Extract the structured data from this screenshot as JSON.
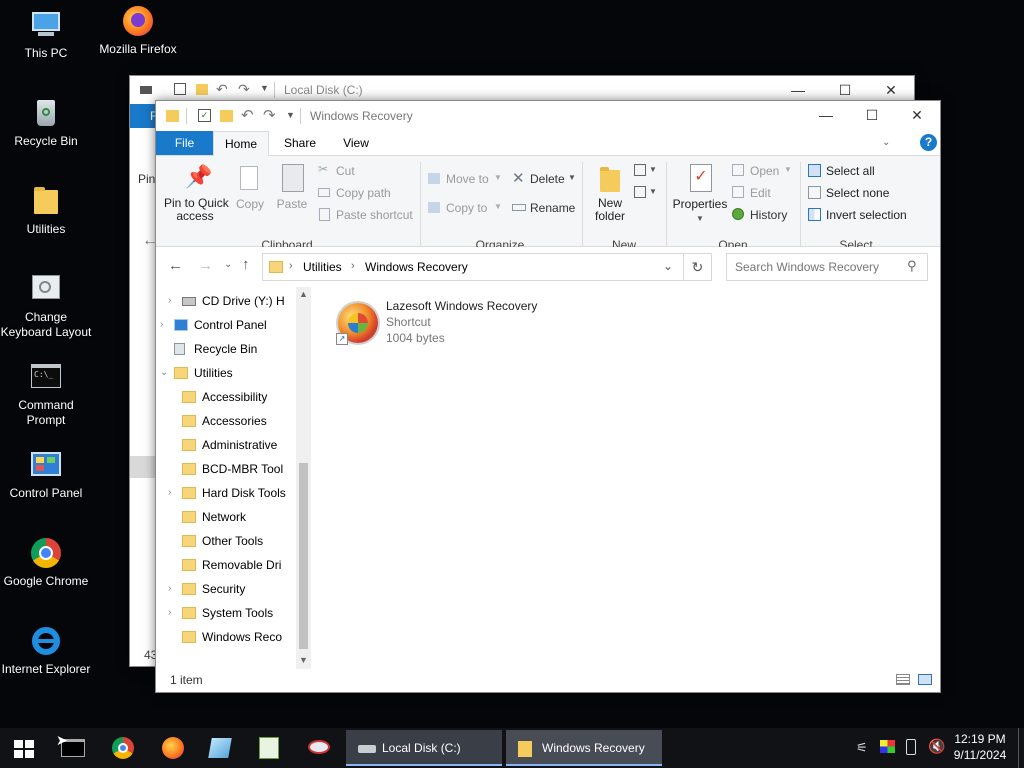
{
  "desktop": {
    "icons": [
      {
        "label": "This PC",
        "icon": "this-pc-icon"
      },
      {
        "label": "Mozilla Firefox",
        "icon": "firefox-icon"
      },
      {
        "label": "Recycle Bin",
        "icon": "recycle-bin-icon"
      },
      {
        "label": "Utilities",
        "icon": "folder-icon"
      },
      {
        "label": "Change Keyboard Layout",
        "icon": "keyboard-layout-icon"
      },
      {
        "label": "Command Prompt",
        "icon": "command-prompt-icon"
      },
      {
        "label": "Control Panel",
        "icon": "control-panel-icon"
      },
      {
        "label": "Google Chrome",
        "icon": "chrome-icon"
      },
      {
        "label": "Internet Explorer",
        "icon": "internet-explorer-icon"
      }
    ]
  },
  "back_window": {
    "title": "Local Disk (C:)",
    "ribbon_fragment": "Pin",
    "ribbon_tab_fragment": "F",
    "status_fragment": "43"
  },
  "explorer": {
    "title": "Windows Recovery",
    "tabs": [
      "File",
      "Home",
      "Share",
      "View"
    ],
    "active_tab": "Home",
    "ribbon": {
      "clipboard": {
        "pin_line1": "Pin to Quick",
        "pin_line2": "access",
        "copy": "Copy",
        "paste": "Paste",
        "cut": "Cut",
        "copy_path": "Copy path",
        "paste_shortcut": "Paste shortcut",
        "group": "Clipboard"
      },
      "organize": {
        "move_to": "Move to",
        "copy_to": "Copy to",
        "delete": "Delete",
        "rename": "Rename",
        "group": "Organize"
      },
      "new": {
        "new_folder_line1": "New",
        "new_folder_line2": "folder",
        "group": "New"
      },
      "open": {
        "properties": "Properties",
        "open": "Open",
        "edit": "Edit",
        "history": "History",
        "group": "Open"
      },
      "select": {
        "select_all": "Select all",
        "select_none": "Select none",
        "invert_selection": "Invert selection",
        "group": "Select"
      }
    },
    "address": {
      "crumbs": [
        "Utilities",
        "Windows Recovery"
      ],
      "search_placeholder": "Search Windows Recovery"
    },
    "tree": [
      {
        "label": "CD Drive (Y:) H",
        "indent": 1,
        "expander": "right",
        "icon": "cd-drive-icon"
      },
      {
        "label": "Control Panel",
        "indent": 0,
        "expander": "right",
        "icon": "control-panel-icon"
      },
      {
        "label": "Recycle Bin",
        "indent": 0,
        "expander": "",
        "icon": "recycle-bin-icon"
      },
      {
        "label": "Utilities",
        "indent": 0,
        "expander": "down",
        "icon": "folder-icon"
      },
      {
        "label": "Accessibility",
        "indent": 1,
        "expander": "",
        "icon": "folder-icon"
      },
      {
        "label": "Accessories",
        "indent": 1,
        "expander": "",
        "icon": "folder-icon"
      },
      {
        "label": "Administrative",
        "indent": 1,
        "expander": "",
        "icon": "folder-icon"
      },
      {
        "label": "BCD-MBR Tool",
        "indent": 1,
        "expander": "",
        "icon": "folder-icon"
      },
      {
        "label": "Hard Disk Tools",
        "indent": 1,
        "expander": "right",
        "icon": "folder-icon"
      },
      {
        "label": "Network",
        "indent": 1,
        "expander": "",
        "icon": "folder-icon"
      },
      {
        "label": "Other Tools",
        "indent": 1,
        "expander": "",
        "icon": "folder-icon"
      },
      {
        "label": "Removable Dri",
        "indent": 1,
        "expander": "",
        "icon": "folder-icon"
      },
      {
        "label": "Security",
        "indent": 1,
        "expander": "right",
        "icon": "folder-icon"
      },
      {
        "label": "System Tools",
        "indent": 1,
        "expander": "right",
        "icon": "folder-icon"
      },
      {
        "label": "Windows Reco",
        "indent": 1,
        "expander": "",
        "icon": "folder-icon"
      }
    ],
    "files": [
      {
        "name": "Lazesoft Windows Recovery",
        "type": "Shortcut",
        "size": "1004 bytes"
      }
    ],
    "status": "1 item"
  },
  "taskbar": {
    "windows": [
      "Local Disk (C:)",
      "Windows Recovery"
    ],
    "time": "12:19 PM",
    "date": "9/11/2024"
  }
}
